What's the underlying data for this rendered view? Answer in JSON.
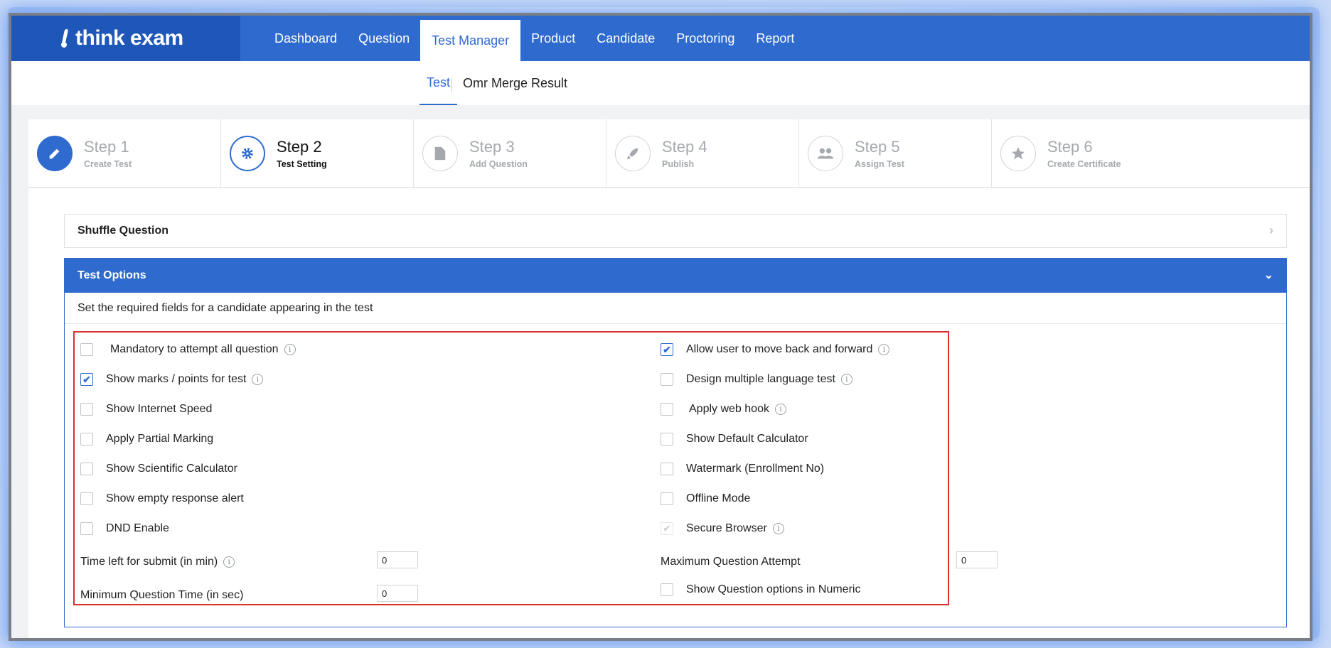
{
  "app": {
    "logo_text": "think exam"
  },
  "nav": {
    "items": [
      {
        "label": "Dashboard"
      },
      {
        "label": "Question"
      },
      {
        "label": "Test Manager"
      },
      {
        "label": "Product"
      },
      {
        "label": "Candidate"
      },
      {
        "label": "Proctoring"
      },
      {
        "label": "Report"
      }
    ],
    "active": "Test Manager"
  },
  "subnav": {
    "test_label": "Test",
    "omr_label": "Omr Merge Result"
  },
  "steps": [
    {
      "title": "Step 1",
      "subtitle": "Create Test",
      "icon": "pencil-icon",
      "state": "done"
    },
    {
      "title": "Step 2",
      "subtitle": "Test Setting",
      "icon": "gear-icon",
      "state": "current"
    },
    {
      "title": "Step 3",
      "subtitle": "Add Question",
      "icon": "document-icon",
      "state": "pending"
    },
    {
      "title": "Step 4",
      "subtitle": "Publish",
      "icon": "rocket-icon",
      "state": "pending"
    },
    {
      "title": "Step 5",
      "subtitle": "Assign Test",
      "icon": "users-icon",
      "state": "pending"
    },
    {
      "title": "Step 6",
      "subtitle": "Create Certificate",
      "icon": "star-icon",
      "state": "pending"
    }
  ],
  "shuffle": {
    "title": "Shuffle Question"
  },
  "test_options": {
    "title": "Test Options",
    "description": "Set the required fields for a candidate appearing in the test",
    "left": [
      {
        "label": "Mandatory to attempt all question",
        "checked": false,
        "info": true
      },
      {
        "label": "Show marks / points for test",
        "checked": true,
        "info": true
      },
      {
        "label": "Show Internet Speed",
        "checked": false,
        "info": false
      },
      {
        "label": "Apply Partial Marking",
        "checked": false,
        "info": false
      },
      {
        "label": "Show Scientific Calculator",
        "checked": false,
        "info": false
      },
      {
        "label": "Show empty response alert",
        "checked": false,
        "info": false
      },
      {
        "label": "DND Enable",
        "checked": false,
        "info": false
      }
    ],
    "right": [
      {
        "label": "Allow user to move back and forward",
        "checked": true,
        "info": true
      },
      {
        "label": "Design multiple language test",
        "checked": false,
        "info": true
      },
      {
        "label": "Apply web hook",
        "checked": false,
        "info": true
      },
      {
        "label": "Show Default Calculator",
        "checked": false,
        "info": false
      },
      {
        "label": "Watermark (Enrollment No)",
        "checked": false,
        "info": false
      },
      {
        "label": "Offline Mode",
        "checked": false,
        "info": false
      },
      {
        "label": "Secure Browser",
        "checked": true,
        "disabled": true,
        "info": true
      }
    ],
    "time_left": {
      "label": "Time left for submit (in min)",
      "value": "0"
    },
    "min_question_time": {
      "label": "Minimum Question Time (in sec)",
      "value": "0"
    },
    "max_attempt": {
      "label": "Maximum Question Attempt",
      "value": "0"
    },
    "numeric_options": {
      "label": "Show Question options in Numeric",
      "checked": false
    }
  },
  "colors": {
    "primary": "#2f6bcf",
    "highlight_border": "#d9302c"
  }
}
